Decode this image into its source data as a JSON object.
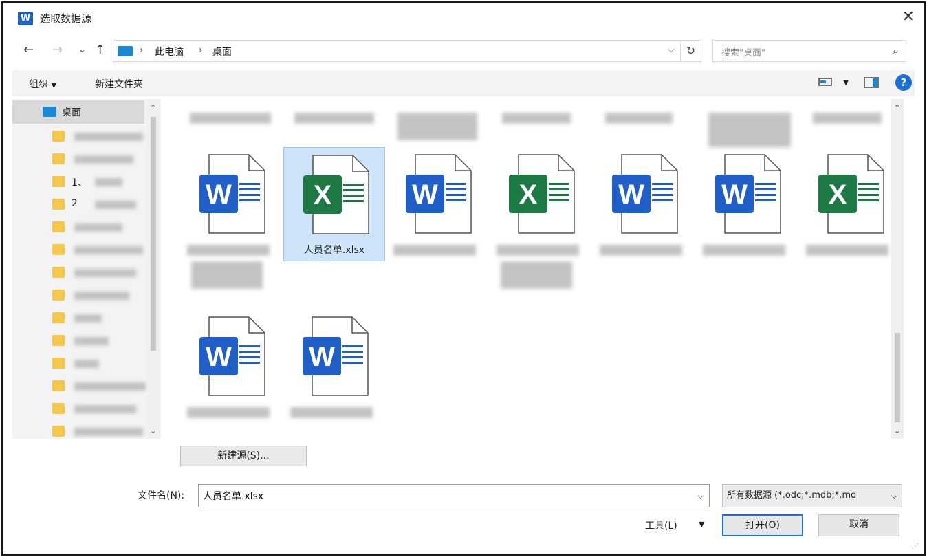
{
  "window": {
    "title": "选取数据源",
    "app_icon": "W"
  },
  "nav": {
    "back": "←",
    "forward": "→",
    "recent": "⌄",
    "up": "↑"
  },
  "address": {
    "crumbs": [
      "此电脑",
      "桌面"
    ],
    "separator": "›"
  },
  "search": {
    "placeholder": "搜索\"桌面\""
  },
  "toolbar": {
    "organize": "组织",
    "new_folder": "新建文件夹",
    "help": "?"
  },
  "navpane": {
    "selected": "桌面",
    "items": [
      {
        "label": ""
      },
      {
        "label": ""
      },
      {
        "label": "1、"
      },
      {
        "label": "2"
      },
      {
        "label": ""
      },
      {
        "label": ""
      },
      {
        "label": ""
      },
      {
        "label": ""
      },
      {
        "label": ""
      },
      {
        "label": ""
      },
      {
        "label": ""
      },
      {
        "label": ""
      },
      {
        "label": ""
      },
      {
        "label": ""
      },
      {
        "label": ""
      }
    ]
  },
  "files": [
    {
      "kind": "word",
      "letter": "W",
      "name": ""
    },
    {
      "kind": "excel",
      "letter": "X",
      "name": "人员名单.xlsx",
      "selected": true
    },
    {
      "kind": "word",
      "letter": "W",
      "name": ""
    },
    {
      "kind": "excel",
      "letter": "X",
      "name": ""
    },
    {
      "kind": "word",
      "letter": "W",
      "name": ""
    },
    {
      "kind": "word",
      "letter": "W",
      "name": ""
    },
    {
      "kind": "excel",
      "letter": "X",
      "name": ""
    },
    {
      "kind": "word",
      "letter": "W",
      "name": ""
    },
    {
      "kind": "word",
      "letter": "W",
      "name": ""
    }
  ],
  "new_source_button": "新建源(S)...",
  "filename": {
    "label": "文件名(N):",
    "value": "人员名单.xlsx"
  },
  "filetype": {
    "value": "所有数据源 (*.odc;*.mdb;*.md"
  },
  "tools": {
    "label": "工具(L)"
  },
  "open_button": "打开(O)",
  "cancel_button": "取消",
  "colors": {
    "word": "#1f5fc7",
    "excel": "#1d7a45",
    "accent": "#1a6fd8",
    "selection": "#cde4f9"
  }
}
